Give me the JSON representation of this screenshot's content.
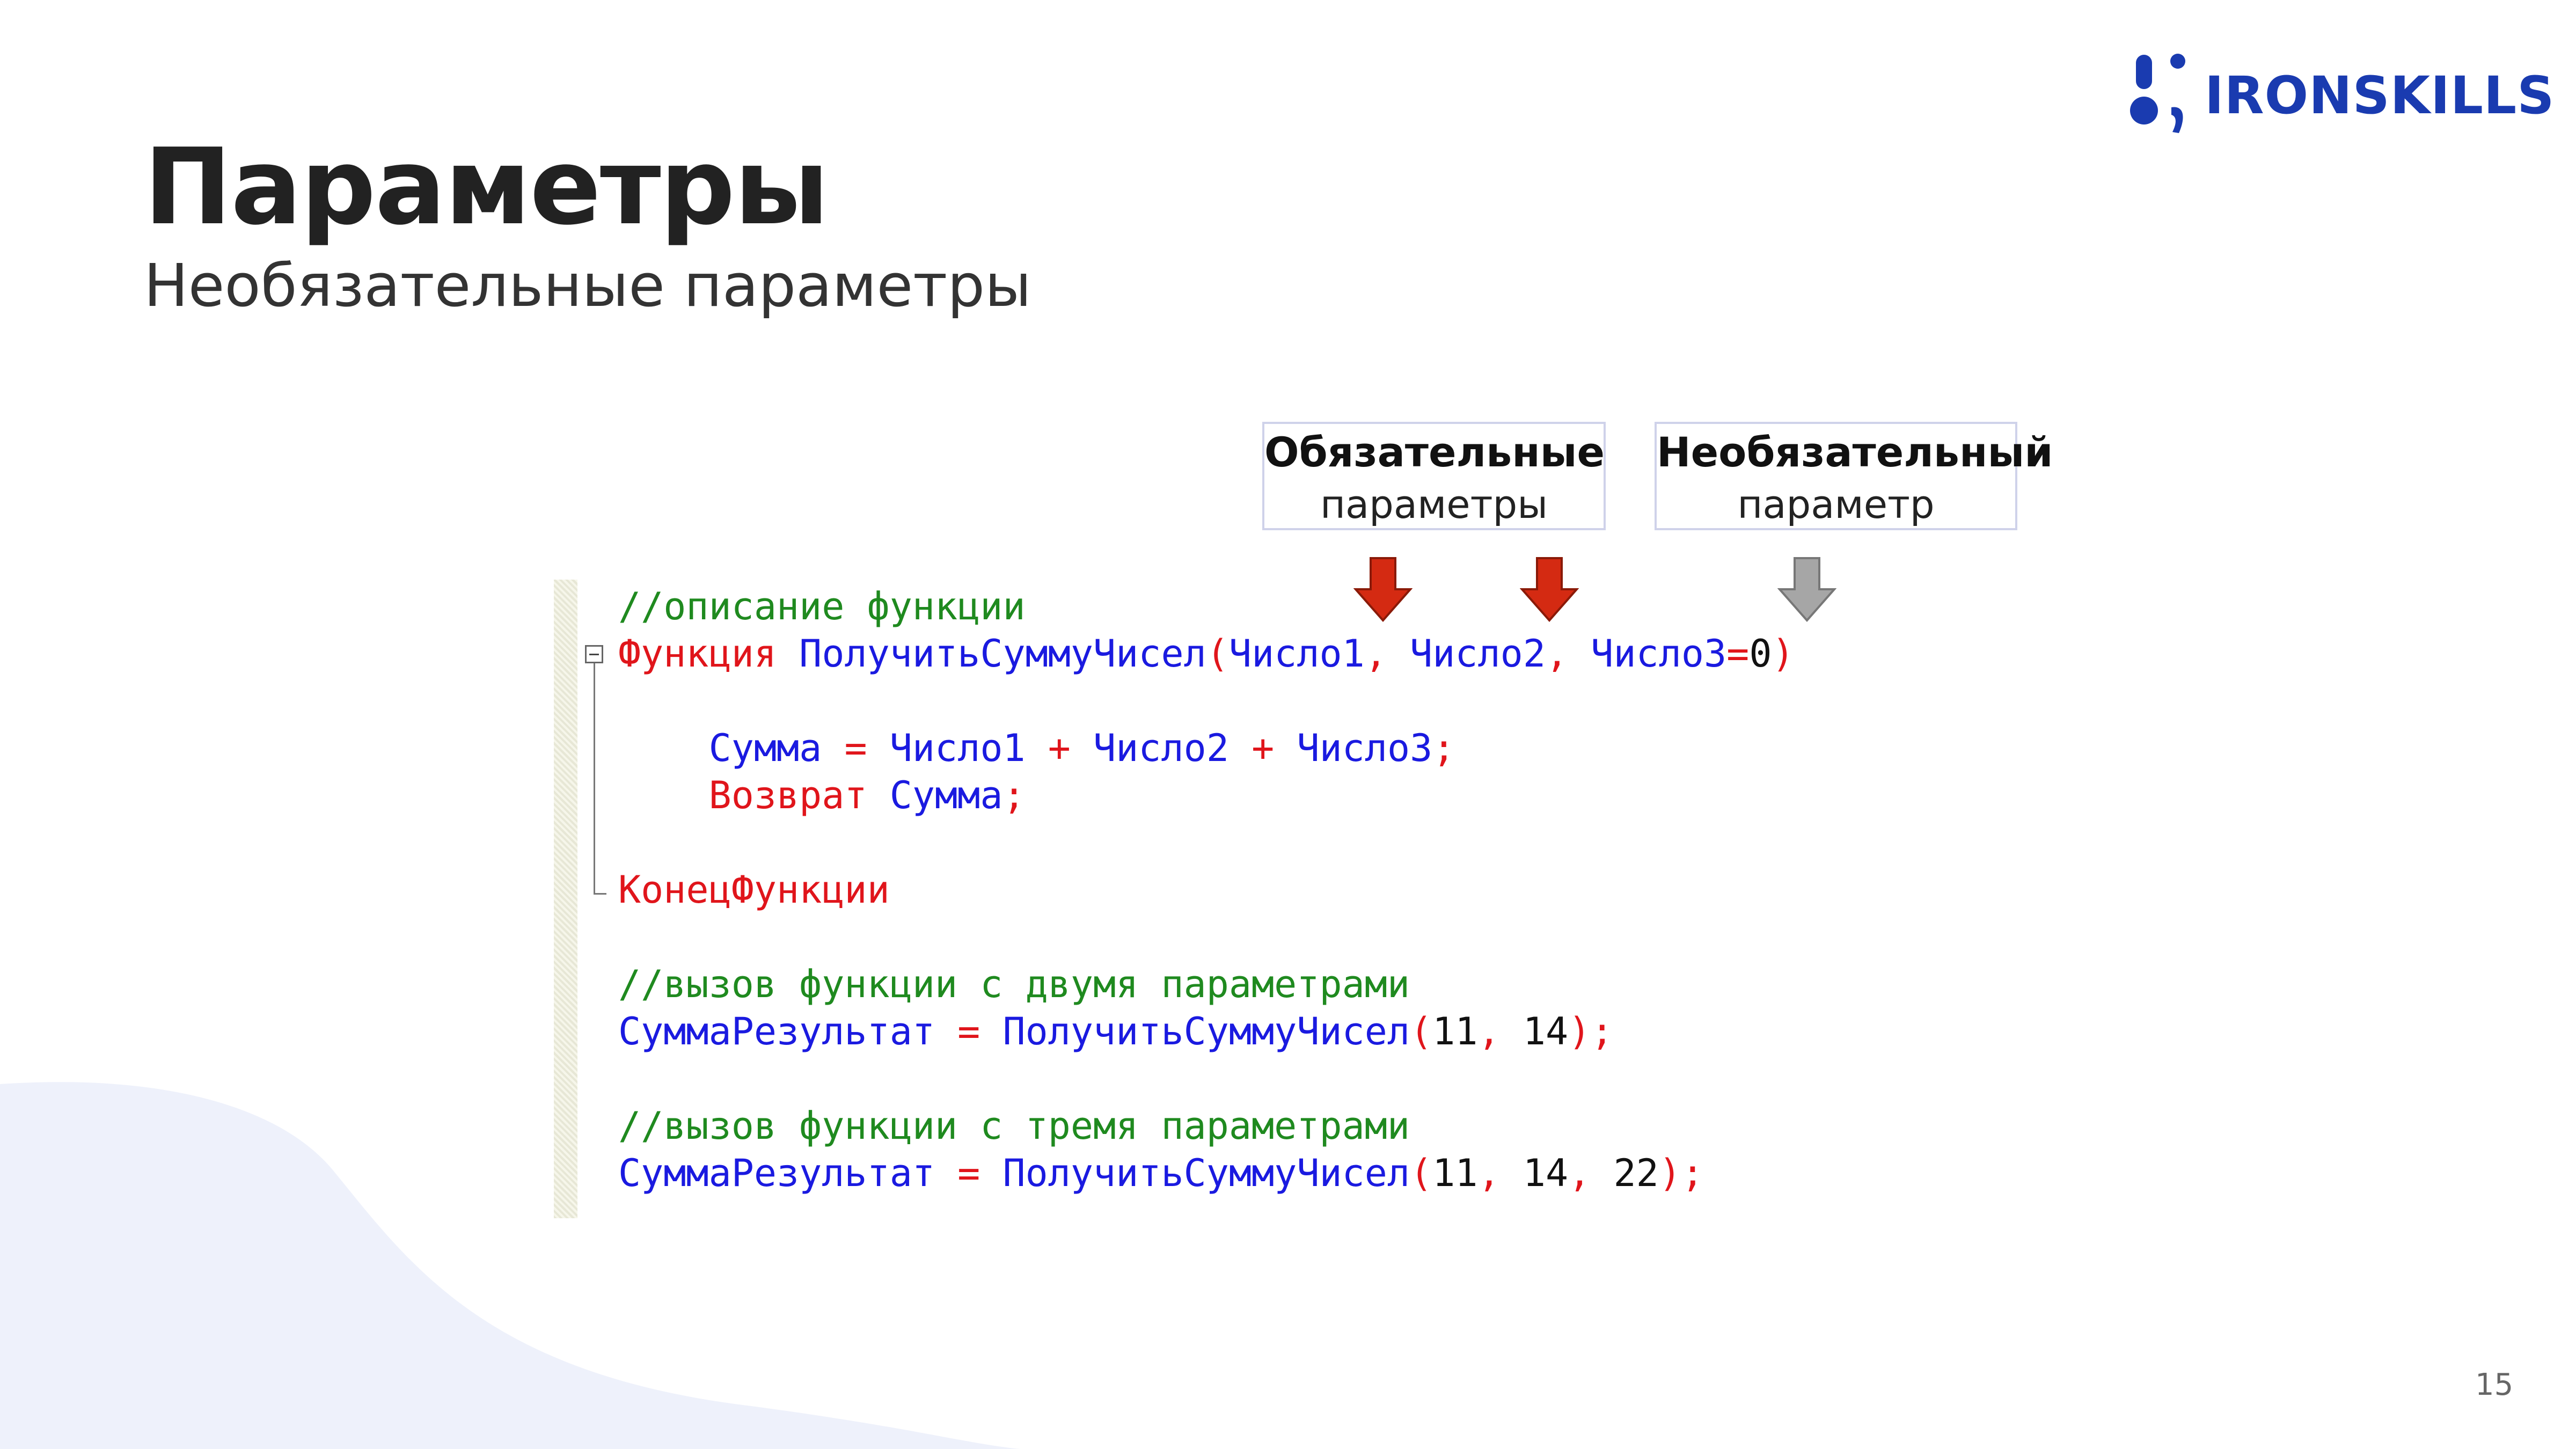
{
  "brand": {
    "name": "IRONSKILLS",
    "color": "#1a3bb0"
  },
  "slide": {
    "title": "Параметры",
    "subtitle": "Необязательные параметры",
    "page_number": "15"
  },
  "labels": {
    "required": {
      "line1": "Обязательные",
      "line2": "параметры"
    },
    "optional": {
      "line1": "Необязательный",
      "line2": "параметр"
    }
  },
  "code": {
    "comment_desc": "//описание функции",
    "kw_function": "Функция",
    "func_name": "ПолучитьСуммуЧисел",
    "param1": "Число1",
    "param2": "Число2",
    "param3": "Число3",
    "default_value": "0",
    "var_sum": "Сумма",
    "kw_return": "Возврат",
    "kw_end_function": "КонецФункции",
    "comment_call2": "//вызов функции с двумя параметрами",
    "comment_call3": "//вызов функции с тремя параметрами",
    "var_result": "СуммаРезультат",
    "arg1": "11",
    "arg2": "14",
    "arg3": "22"
  },
  "colors": {
    "comment": "#1f8a1f",
    "keyword": "#e0151b",
    "identifier": "#1a1ae0",
    "arrow_required": "#d42a12",
    "arrow_optional": "#a6a6a6"
  }
}
